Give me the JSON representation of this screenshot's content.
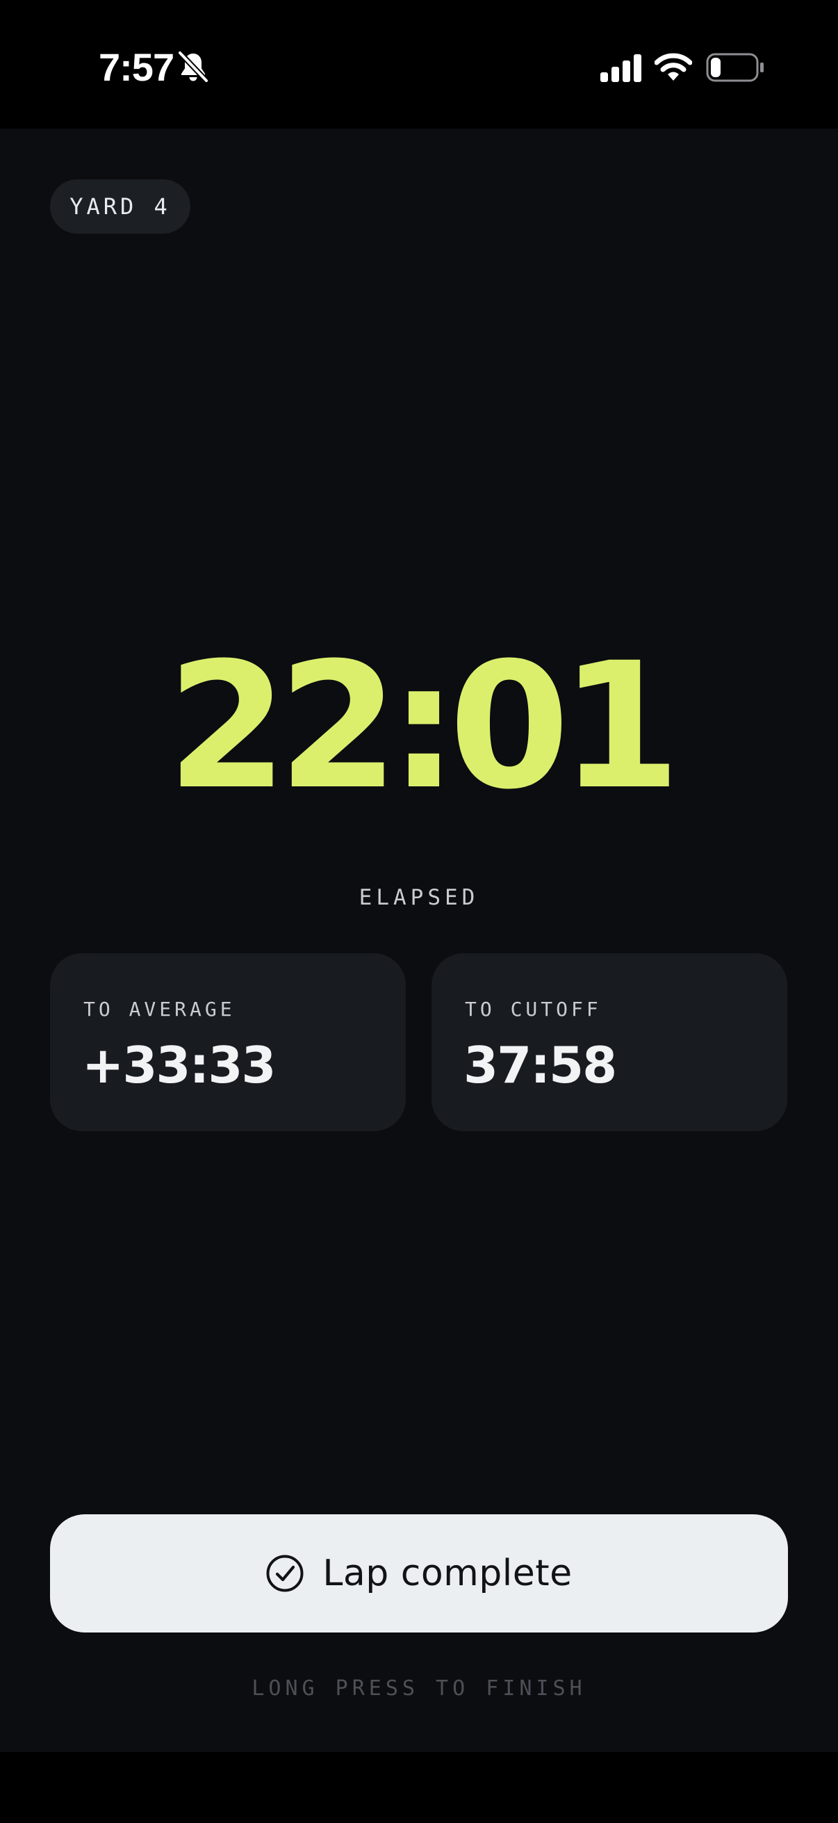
{
  "status_bar": {
    "time": "7:57",
    "icons": [
      "bell-slash-icon",
      "cellular-signal-icon",
      "wifi-icon",
      "battery-icon"
    ],
    "battery_level": 0.2
  },
  "yard": {
    "label": "YARD 4"
  },
  "timer": {
    "elapsed": "22:01",
    "elapsed_label": "ELAPSED"
  },
  "stats": [
    {
      "label": "TO AVERAGE",
      "value": "+33:33"
    },
    {
      "label": "TO CUTOFF",
      "value": "37:58"
    }
  ],
  "actions": {
    "lap_button_label": "Lap complete",
    "lap_button_icon": "check-circle-icon",
    "hint": "LONG PRESS TO FINISH"
  },
  "colors": {
    "accent": "#dbef6c",
    "background": "#0b0d10",
    "card": "#181b1f",
    "button": "#eceff2"
  }
}
